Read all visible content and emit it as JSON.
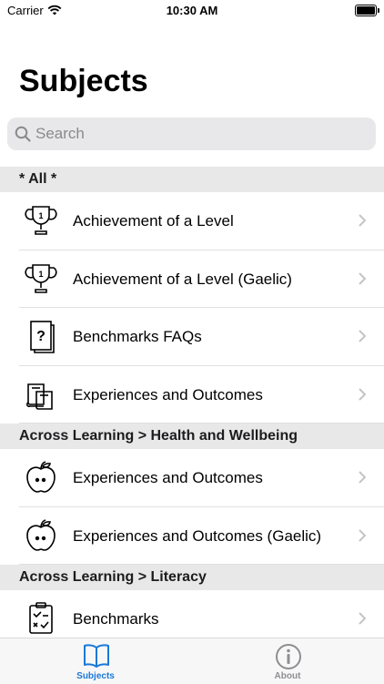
{
  "status": {
    "carrier": "Carrier",
    "time": "10:30 AM"
  },
  "page": {
    "title": "Subjects",
    "search_placeholder": "Search"
  },
  "sections": [
    {
      "header": "* All *",
      "rows": [
        {
          "icon": "trophy-icon",
          "label": "Achievement of a Level"
        },
        {
          "icon": "trophy-icon",
          "label": "Achievement of a Level (Gaelic)"
        },
        {
          "icon": "question-document-icon",
          "label": "Benchmarks FAQs"
        },
        {
          "icon": "books-icon",
          "label": "Experiences and Outcomes"
        }
      ]
    },
    {
      "header": "Across Learning > Health and Wellbeing",
      "rows": [
        {
          "icon": "apple-icon",
          "label": "Experiences and Outcomes"
        },
        {
          "icon": "apple-icon",
          "label": "Experiences and Outcomes (Gaelic)"
        }
      ]
    },
    {
      "header": "Across Learning > Literacy",
      "rows": [
        {
          "icon": "checklist-icon",
          "label": "Benchmarks"
        }
      ]
    }
  ],
  "tabbar": {
    "tabs": [
      {
        "icon": "book-icon",
        "label": "Subjects",
        "active": true
      },
      {
        "icon": "info-icon",
        "label": "About",
        "active": false
      }
    ],
    "active_color": "#1a78d8",
    "inactive_color": "#8e8e93"
  }
}
